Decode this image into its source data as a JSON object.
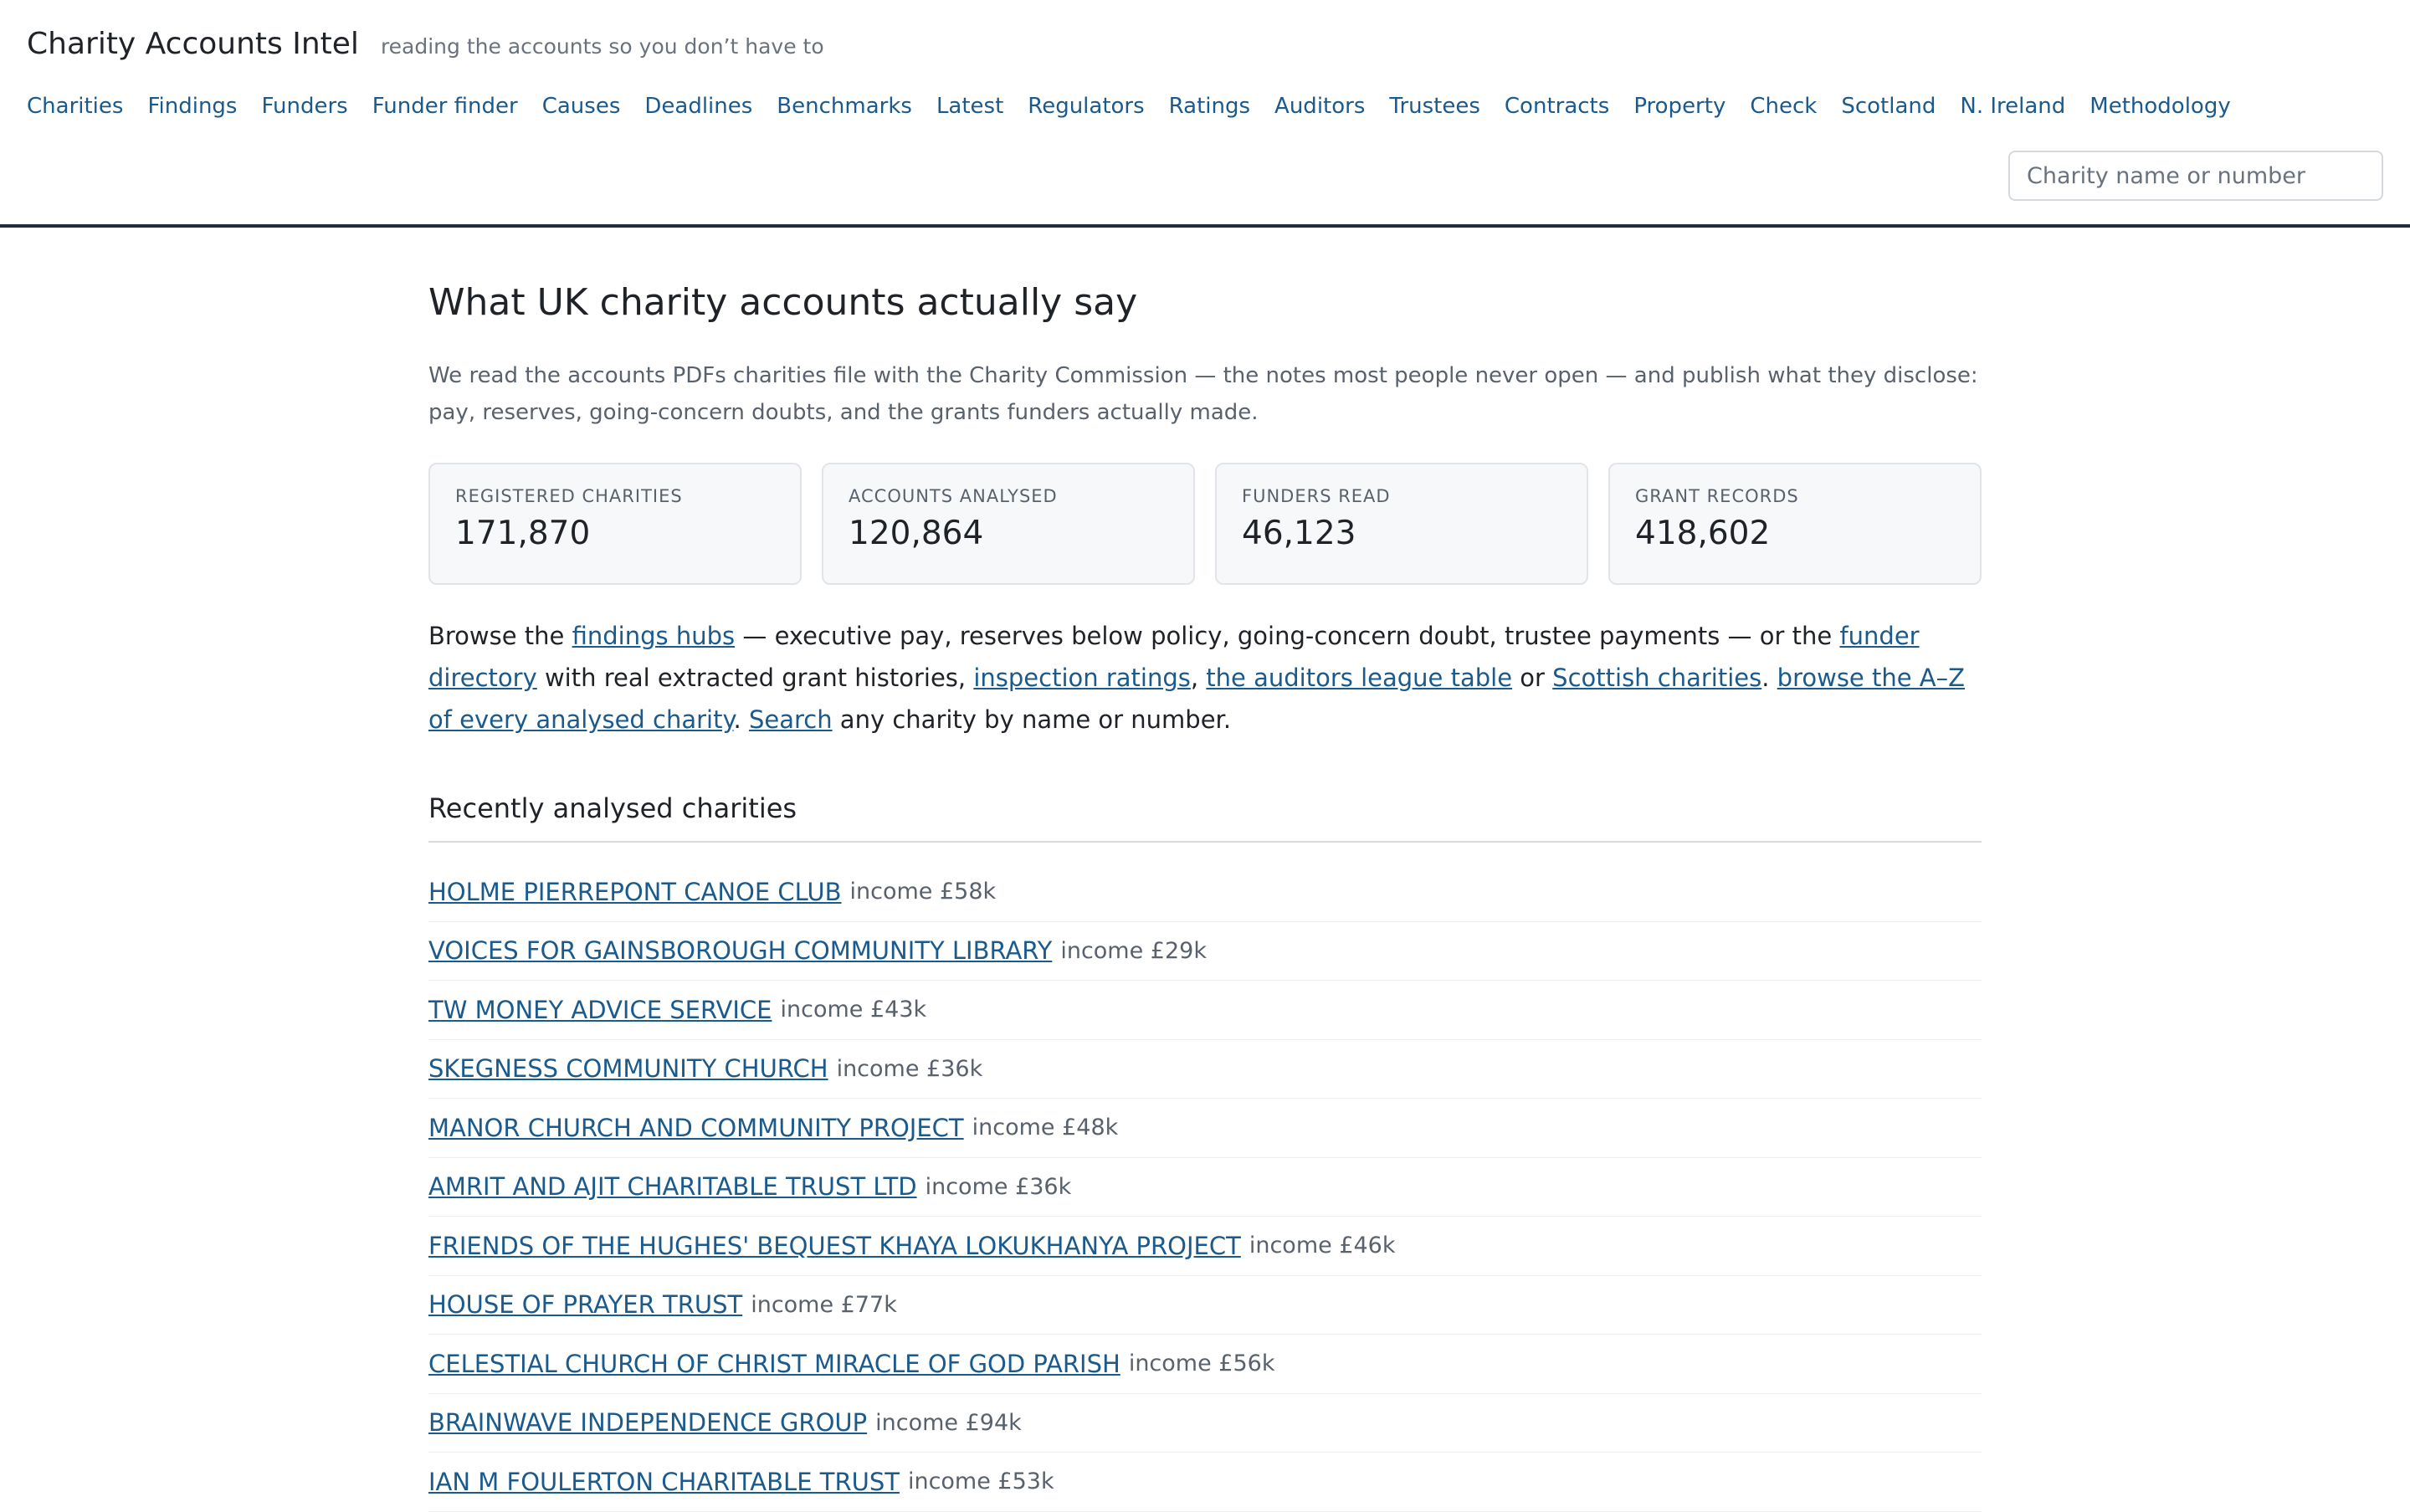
{
  "header": {
    "brand": "Charity Accounts Intel",
    "tagline": "reading the accounts so you don’t have to",
    "nav": [
      "Charities",
      "Findings",
      "Funders",
      "Funder finder",
      "Causes",
      "Deadlines",
      "Benchmarks",
      "Latest",
      "Regulators",
      "Ratings",
      "Auditors",
      "Trustees",
      "Contracts",
      "Property",
      "Check",
      "Scotland",
      "N. Ireland",
      "Methodology"
    ],
    "search_placeholder": "Charity name or number"
  },
  "main": {
    "title": "What UK charity accounts actually say",
    "intro": "We read the accounts PDFs charities file with the Charity Commission — the notes most people never open — and publish what they disclose: pay, reserves, going-concern doubts, and the grants funders actually made.",
    "stats": [
      {
        "label": "REGISTERED CHARITIES",
        "value": "171,870"
      },
      {
        "label": "ACCOUNTS ANALYSED",
        "value": "120,864"
      },
      {
        "label": "FUNDERS READ",
        "value": "46,123"
      },
      {
        "label": "GRANT RECORDS",
        "value": "418,602"
      }
    ],
    "browse": {
      "t1": "Browse the ",
      "findings_link": "findings hubs",
      "t2": " — executive pay, reserves below policy, going-concern doubt, trustee payments — or the ",
      "funder_link": "funder directory",
      "t3": " with real extracted grant histories, ",
      "ratings_link": "inspection ratings",
      "t4": ", ",
      "auditors_link": "the auditors league table",
      "t5": " or ",
      "scottish_link": "Scottish charities",
      "t6": ". ",
      "az_link": "browse the A–Z of every analysed charity",
      "t7": ". ",
      "search_link": "Search",
      "t8": " any charity by name or number."
    },
    "recent_title": "Recently analysed charities",
    "recent": [
      {
        "name": "HOLME PIERREPONT CANOE CLUB",
        "income": "income £58k"
      },
      {
        "name": "VOICES FOR GAINSBOROUGH COMMUNITY LIBRARY",
        "income": "income £29k"
      },
      {
        "name": "TW MONEY ADVICE SERVICE",
        "income": "income £43k"
      },
      {
        "name": "SKEGNESS COMMUNITY CHURCH",
        "income": "income £36k"
      },
      {
        "name": "MANOR CHURCH AND COMMUNITY PROJECT",
        "income": "income £48k"
      },
      {
        "name": "AMRIT AND AJIT CHARITABLE TRUST LTD",
        "income": "income £36k"
      },
      {
        "name": "FRIENDS OF THE HUGHES' BEQUEST KHAYA LOKUKHANYA PROJECT",
        "income": "income £46k"
      },
      {
        "name": "HOUSE OF PRAYER TRUST",
        "income": "income £77k"
      },
      {
        "name": "CELESTIAL CHURCH OF CHRIST MIRACLE OF GOD PARISH",
        "income": "income £56k"
      },
      {
        "name": "BRAINWAVE INDEPENDENCE GROUP",
        "income": "income £94k"
      },
      {
        "name": "IAN M FOULERTON CHARITABLE TRUST",
        "income": "income £53k"
      }
    ]
  }
}
